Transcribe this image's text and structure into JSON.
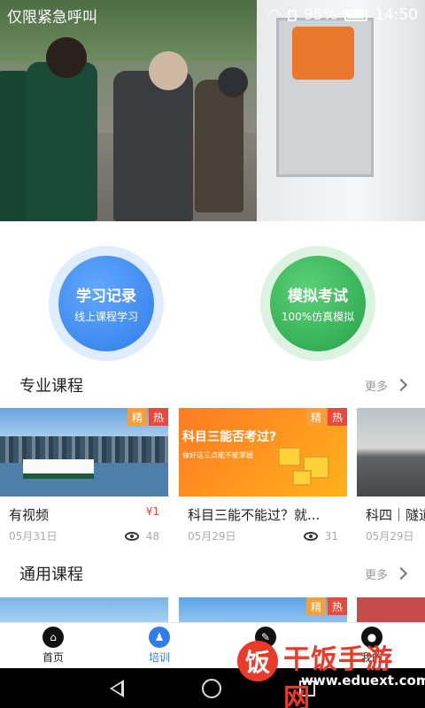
{
  "status_bar": {
    "carrier": "仅限紧急呼叫",
    "battery": "95%",
    "time": "14:50"
  },
  "hero": {
    "alt": ""
  },
  "quick_actions": [
    {
      "title": "学习记录",
      "subtitle": "线上课程学习",
      "color": "#2f7de8"
    },
    {
      "title": "模拟考试",
      "subtitle": "100%仿真模拟",
      "color": "#27a049"
    }
  ],
  "sections": {
    "professional": {
      "title": "专业课程",
      "more": "更多",
      "cards": [
        {
          "title": "有视频",
          "price": "¥1",
          "date": "05月31日",
          "views": "48",
          "badges": [
            "精",
            "热"
          ]
        },
        {
          "title": "科目三能不能过？就...",
          "date": "05月29日",
          "views": "31",
          "badges": [
            "精",
            "热"
          ],
          "thumb_text": "科目三能否考过?",
          "thumb_sub": "做好这三点能不能掌握"
        },
        {
          "title": "科四｜隧道",
          "date": "05月29日",
          "views": ""
        }
      ]
    },
    "general": {
      "title": "通用课程",
      "more": "更多",
      "cards": [
        {
          "badges": []
        },
        {
          "badges": [
            "精",
            "热"
          ]
        },
        {
          "badges": []
        }
      ]
    }
  },
  "bottom_nav": [
    {
      "label": "首页",
      "icon": "home-icon",
      "active": false
    },
    {
      "label": "培训",
      "icon": "training-icon",
      "active": true
    },
    {
      "label": "考试",
      "icon": "exam-icon",
      "active": false
    },
    {
      "label": "我的",
      "icon": "profile-icon",
      "active": false
    }
  ],
  "watermark": {
    "logo_char": "饭",
    "brand": "干饭手游网",
    "url": "www.eduext.com"
  },
  "accent": "#2f7de8",
  "badge_colors": {
    "jing": "#f2a03d",
    "re": "#e9483a"
  }
}
